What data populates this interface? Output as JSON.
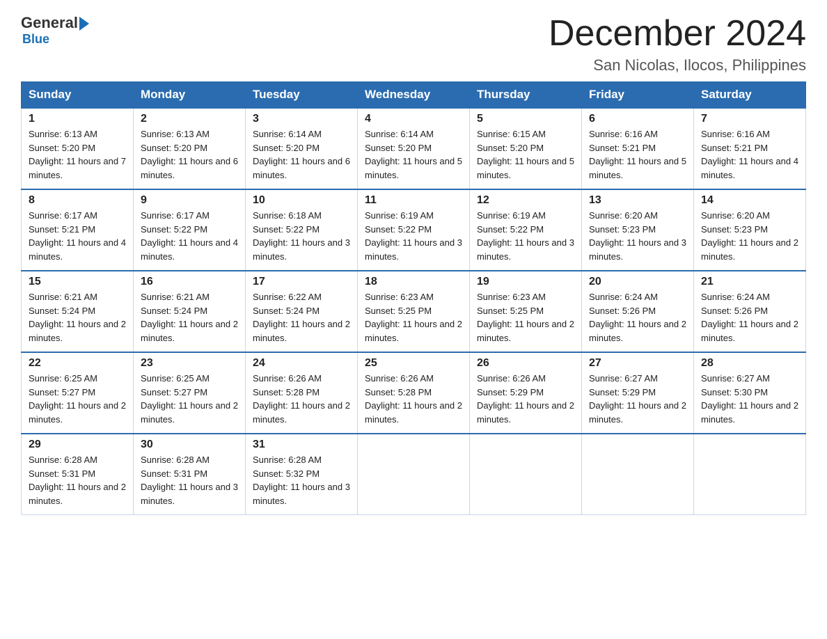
{
  "header": {
    "logo_general": "General",
    "logo_blue": "Blue",
    "month_title": "December 2024",
    "location": "San Nicolas, Ilocos, Philippines"
  },
  "days_of_week": [
    "Sunday",
    "Monday",
    "Tuesday",
    "Wednesday",
    "Thursday",
    "Friday",
    "Saturday"
  ],
  "weeks": [
    [
      {
        "day": "1",
        "sunrise": "6:13 AM",
        "sunset": "5:20 PM",
        "daylight": "11 hours and 7 minutes."
      },
      {
        "day": "2",
        "sunrise": "6:13 AM",
        "sunset": "5:20 PM",
        "daylight": "11 hours and 6 minutes."
      },
      {
        "day": "3",
        "sunrise": "6:14 AM",
        "sunset": "5:20 PM",
        "daylight": "11 hours and 6 minutes."
      },
      {
        "day": "4",
        "sunrise": "6:14 AM",
        "sunset": "5:20 PM",
        "daylight": "11 hours and 5 minutes."
      },
      {
        "day": "5",
        "sunrise": "6:15 AM",
        "sunset": "5:20 PM",
        "daylight": "11 hours and 5 minutes."
      },
      {
        "day": "6",
        "sunrise": "6:16 AM",
        "sunset": "5:21 PM",
        "daylight": "11 hours and 5 minutes."
      },
      {
        "day": "7",
        "sunrise": "6:16 AM",
        "sunset": "5:21 PM",
        "daylight": "11 hours and 4 minutes."
      }
    ],
    [
      {
        "day": "8",
        "sunrise": "6:17 AM",
        "sunset": "5:21 PM",
        "daylight": "11 hours and 4 minutes."
      },
      {
        "day": "9",
        "sunrise": "6:17 AM",
        "sunset": "5:22 PM",
        "daylight": "11 hours and 4 minutes."
      },
      {
        "day": "10",
        "sunrise": "6:18 AM",
        "sunset": "5:22 PM",
        "daylight": "11 hours and 3 minutes."
      },
      {
        "day": "11",
        "sunrise": "6:19 AM",
        "sunset": "5:22 PM",
        "daylight": "11 hours and 3 minutes."
      },
      {
        "day": "12",
        "sunrise": "6:19 AM",
        "sunset": "5:22 PM",
        "daylight": "11 hours and 3 minutes."
      },
      {
        "day": "13",
        "sunrise": "6:20 AM",
        "sunset": "5:23 PM",
        "daylight": "11 hours and 3 minutes."
      },
      {
        "day": "14",
        "sunrise": "6:20 AM",
        "sunset": "5:23 PM",
        "daylight": "11 hours and 2 minutes."
      }
    ],
    [
      {
        "day": "15",
        "sunrise": "6:21 AM",
        "sunset": "5:24 PM",
        "daylight": "11 hours and 2 minutes."
      },
      {
        "day": "16",
        "sunrise": "6:21 AM",
        "sunset": "5:24 PM",
        "daylight": "11 hours and 2 minutes."
      },
      {
        "day": "17",
        "sunrise": "6:22 AM",
        "sunset": "5:24 PM",
        "daylight": "11 hours and 2 minutes."
      },
      {
        "day": "18",
        "sunrise": "6:23 AM",
        "sunset": "5:25 PM",
        "daylight": "11 hours and 2 minutes."
      },
      {
        "day": "19",
        "sunrise": "6:23 AM",
        "sunset": "5:25 PM",
        "daylight": "11 hours and 2 minutes."
      },
      {
        "day": "20",
        "sunrise": "6:24 AM",
        "sunset": "5:26 PM",
        "daylight": "11 hours and 2 minutes."
      },
      {
        "day": "21",
        "sunrise": "6:24 AM",
        "sunset": "5:26 PM",
        "daylight": "11 hours and 2 minutes."
      }
    ],
    [
      {
        "day": "22",
        "sunrise": "6:25 AM",
        "sunset": "5:27 PM",
        "daylight": "11 hours and 2 minutes."
      },
      {
        "day": "23",
        "sunrise": "6:25 AM",
        "sunset": "5:27 PM",
        "daylight": "11 hours and 2 minutes."
      },
      {
        "day": "24",
        "sunrise": "6:26 AM",
        "sunset": "5:28 PM",
        "daylight": "11 hours and 2 minutes."
      },
      {
        "day": "25",
        "sunrise": "6:26 AM",
        "sunset": "5:28 PM",
        "daylight": "11 hours and 2 minutes."
      },
      {
        "day": "26",
        "sunrise": "6:26 AM",
        "sunset": "5:29 PM",
        "daylight": "11 hours and 2 minutes."
      },
      {
        "day": "27",
        "sunrise": "6:27 AM",
        "sunset": "5:29 PM",
        "daylight": "11 hours and 2 minutes."
      },
      {
        "day": "28",
        "sunrise": "6:27 AM",
        "sunset": "5:30 PM",
        "daylight": "11 hours and 2 minutes."
      }
    ],
    [
      {
        "day": "29",
        "sunrise": "6:28 AM",
        "sunset": "5:31 PM",
        "daylight": "11 hours and 2 minutes."
      },
      {
        "day": "30",
        "sunrise": "6:28 AM",
        "sunset": "5:31 PM",
        "daylight": "11 hours and 3 minutes."
      },
      {
        "day": "31",
        "sunrise": "6:28 AM",
        "sunset": "5:32 PM",
        "daylight": "11 hours and 3 minutes."
      },
      null,
      null,
      null,
      null
    ]
  ]
}
